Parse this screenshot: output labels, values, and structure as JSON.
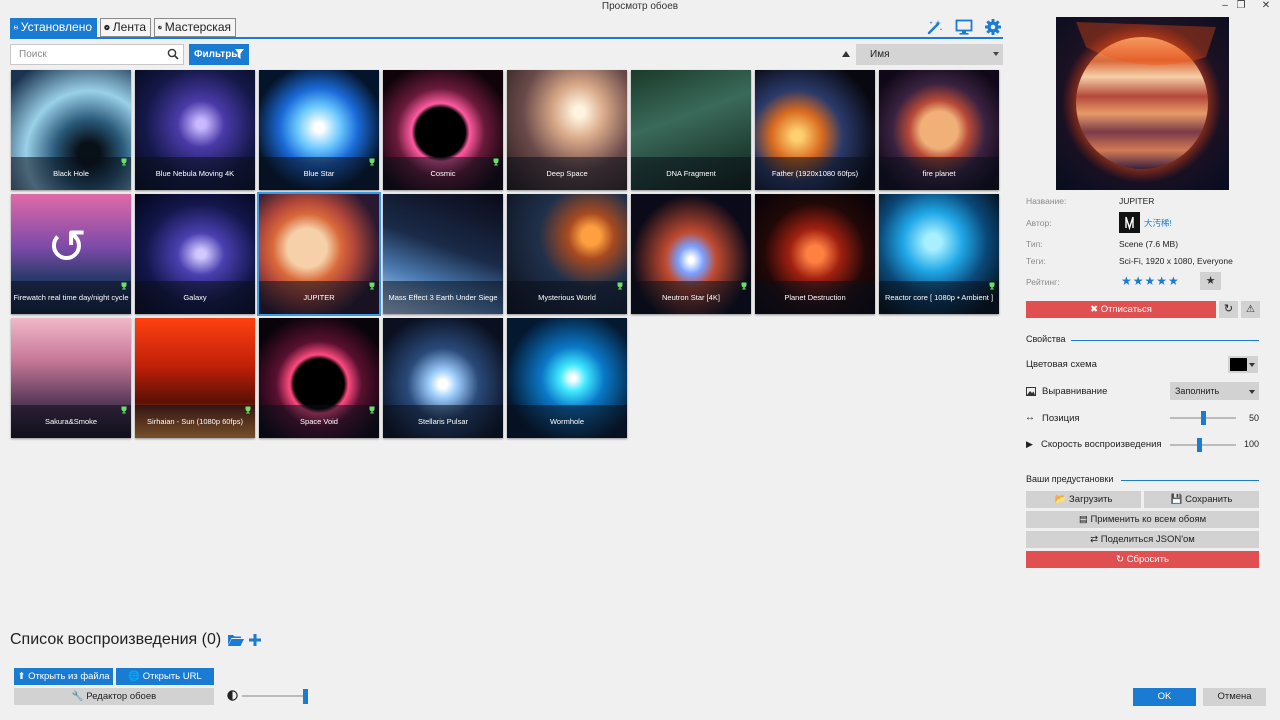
{
  "window": {
    "title": "Просмотр обоев"
  },
  "tabs": [
    {
      "label": "Установлено",
      "icon": "save-icon",
      "active": true
    },
    {
      "label": "Лента",
      "icon": "compass-icon",
      "active": false
    },
    {
      "label": "Мастерская",
      "icon": "steam-icon",
      "active": false
    }
  ],
  "toolbar": {
    "search_placeholder": "Поиск",
    "filters_label": "Фильтры",
    "sort_value": "Имя"
  },
  "wallpapers": [
    {
      "title": "Black Hole",
      "trophy": true
    },
    {
      "title": "Blue Nebula Moving 4K",
      "trophy": false
    },
    {
      "title": "Blue Star",
      "trophy": true
    },
    {
      "title": "Cosmic",
      "trophy": true
    },
    {
      "title": "Deep Space",
      "trophy": false
    },
    {
      "title": "DNA Fragment",
      "trophy": false
    },
    {
      "title": "Father (1920x1080 60fps)",
      "trophy": false
    },
    {
      "title": "fire planet",
      "trophy": false
    },
    {
      "title": "Firewatch real time day/night cycle",
      "trophy": true
    },
    {
      "title": "Galaxy",
      "trophy": false
    },
    {
      "title": "JUPITER",
      "trophy": true,
      "selected": true
    },
    {
      "title": "Mass Effect 3 Earth Under Siege",
      "trophy": false
    },
    {
      "title": "Mysterious World",
      "trophy": true
    },
    {
      "title": "Neutron Star [4K]",
      "trophy": true
    },
    {
      "title": "Planet Destruction",
      "trophy": false
    },
    {
      "title": "Reactor core [ 1080p • Ambient ]",
      "trophy": true
    },
    {
      "title": "Sakura&Smoke",
      "trophy": true
    },
    {
      "title": "Sirhaian - Sun (1080p 60fps)",
      "trophy": true
    },
    {
      "title": "Space Void",
      "trophy": true
    },
    {
      "title": "Stellaris Pulsar",
      "trophy": false
    },
    {
      "title": "Wormhole",
      "trophy": false
    }
  ],
  "details": {
    "name_label": "Название:",
    "name_value": "JUPITER",
    "author_label": "Автор:",
    "author_value": "大汚稀!",
    "type_label": "Тип:",
    "type_value": "Scene (7.6 MB)",
    "tags_label": "Теги:",
    "tags_value": "Sci-Fi, 1920 x 1080, Everyone",
    "rating_label": "Рейтинг:",
    "rating_stars": 5,
    "unsubscribe_label": "Отписаться"
  },
  "properties": {
    "section_title": "Свойства",
    "color_scheme_label": "Цветовая схема",
    "color_scheme_value": "#000000",
    "alignment_label": "Выравнивание",
    "alignment_value": "Заполнить",
    "position_label": "Позиция",
    "position_value": "50",
    "position_fraction": 0.5,
    "speed_label": "Скорость воспроизведения",
    "speed_value": "100",
    "speed_fraction": 0.45
  },
  "presets": {
    "section_title": "Ваши предустановки",
    "load_label": "Загрузить",
    "save_label": "Сохранить",
    "apply_all_label": "Применить ко всем обоям",
    "share_json_label": "Поделиться JSON'ом",
    "reset_label": "Сбросить"
  },
  "playlist": {
    "title": "Список воспроизведения (0)"
  },
  "bottom": {
    "open_file_label": "Открыть из файла",
    "open_url_label": "Открыть URL",
    "editor_label": "Редактор обоев",
    "brightness_fraction": 1.0,
    "ok_label": "OK",
    "cancel_label": "Отмена"
  },
  "colors": {
    "accent": "#1a7bd3",
    "danger": "#e05050"
  }
}
